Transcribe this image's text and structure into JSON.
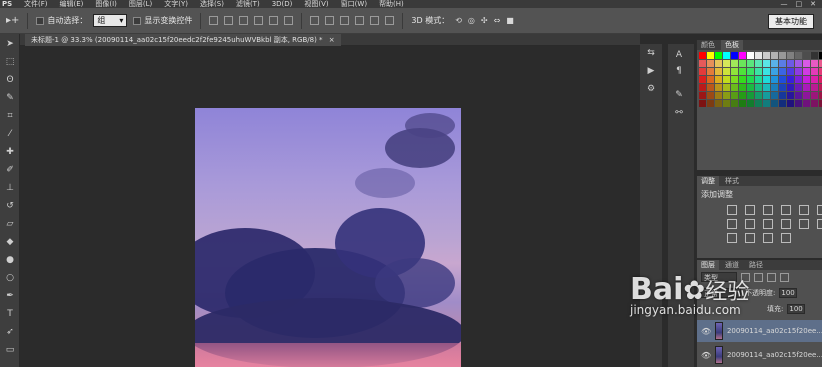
{
  "app": {
    "logo": "PS"
  },
  "menu": [
    "文件(F)",
    "编辑(E)",
    "图像(I)",
    "图层(L)",
    "文字(Y)",
    "选择(S)",
    "滤镜(T)",
    "3D(D)",
    "视图(V)",
    "窗口(W)",
    "帮助(H)"
  ],
  "window_controls": {
    "minimize": "—",
    "maximize": "□",
    "close": "✕"
  },
  "options": {
    "auto_select_label": "自动选择：",
    "auto_select_value": "组",
    "show_transform_label": "显示变换控件",
    "mode_3d_label": "3D 模式：",
    "workspace": "基本功能"
  },
  "document": {
    "tab_title": "未标题-1 @ 33.3% (20090114_aa02c15f20eedc2f2fe9245uhuWVBkbl 副本, RGB/8) *",
    "close": "×"
  },
  "colors_panel": {
    "tabs": [
      "颜色",
      "色板"
    ]
  },
  "adjustments_panel": {
    "tabs": [
      "调整",
      "样式"
    ],
    "title": "添加调整"
  },
  "layers_panel": {
    "tabs": [
      "图层",
      "通道",
      "路径"
    ],
    "filter_label": "类型",
    "blend_mode": "正常",
    "opacity_label": "不透明度:",
    "opacity_value": "100",
    "fill_label": "填充:",
    "fill_value": "100",
    "layers": [
      {
        "name": "20090114_aa02c15f20ee..."
      },
      {
        "name": "20090114_aa02c15f20ee..."
      }
    ]
  },
  "watermark": {
    "brand": "Bai",
    "brand_suffix": "经验",
    "url": "jingyan.baidu.com"
  },
  "swatch_colors": [
    "#ff0000",
    "#ffff00",
    "#00ff00",
    "#00ffff",
    "#0000ff",
    "#ff00ff",
    "#ffffff",
    "#e6e6e6",
    "#cccccc",
    "#b3b3b3",
    "#999999",
    "#808080",
    "#666666",
    "#4d4d4d",
    "#333333",
    "#000000"
  ]
}
